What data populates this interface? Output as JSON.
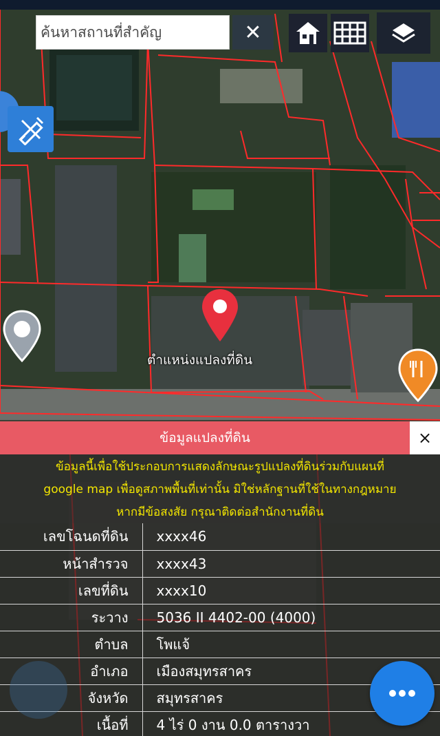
{
  "search": {
    "placeholder": "ค้นหาสถานที่สำคัญ"
  },
  "toolbar": {
    "clear_icon": "close-icon",
    "home_icon": "home-icon",
    "grid_icon": "grid-icon",
    "layers_icon": "layers-icon",
    "measure_icon": "ruler-pencil-icon"
  },
  "map": {
    "parcel_label": "ตำแหน่งแปลงที่ดิน",
    "pin_color": "#e8303e",
    "boundary_color": "#ff2a2a"
  },
  "panel": {
    "title": "ข้อมูลแปลงที่ดิน",
    "close_label": "×",
    "header_color": "#e85a64",
    "notice_color": "#f3e600",
    "notice_lines": [
      "ข้อมูลนี้เพื่อใช้ประกอบการแสดงลักษณะรูปแปลงที่ดินร่วมกับแผนที่",
      "google map เพื่อดูสภาพพื้นที่เท่านั้น มิใช่หลักฐานที่ใช้ในทางกฎหมาย",
      "หากมีข้อสงสัย กรุณาติดต่อสำนักงานที่ดิน"
    ],
    "rows": [
      {
        "label": "เลขโฉนดที่ดิน",
        "value": "xxxx46"
      },
      {
        "label": "หน้าสำรวจ",
        "value": "xxxx43"
      },
      {
        "label": "เลขที่ดิน",
        "value": "xxxx10"
      },
      {
        "label": "ระวาง",
        "value": "5036 II 4402-00 (4000)"
      },
      {
        "label": "ตำบล",
        "value": "โพแจ้"
      },
      {
        "label": "อำเภอ",
        "value": "เมืองสมุทรสาคร"
      },
      {
        "label": "จังหวัด",
        "value": "สมุทรสาคร"
      },
      {
        "label": "เนื้อที่",
        "value": "4 ไร่ 0 งาน 0.0 ตารางวา"
      }
    ]
  },
  "fab": {
    "icon": "more-dots-icon",
    "color": "#1f7fe6"
  }
}
